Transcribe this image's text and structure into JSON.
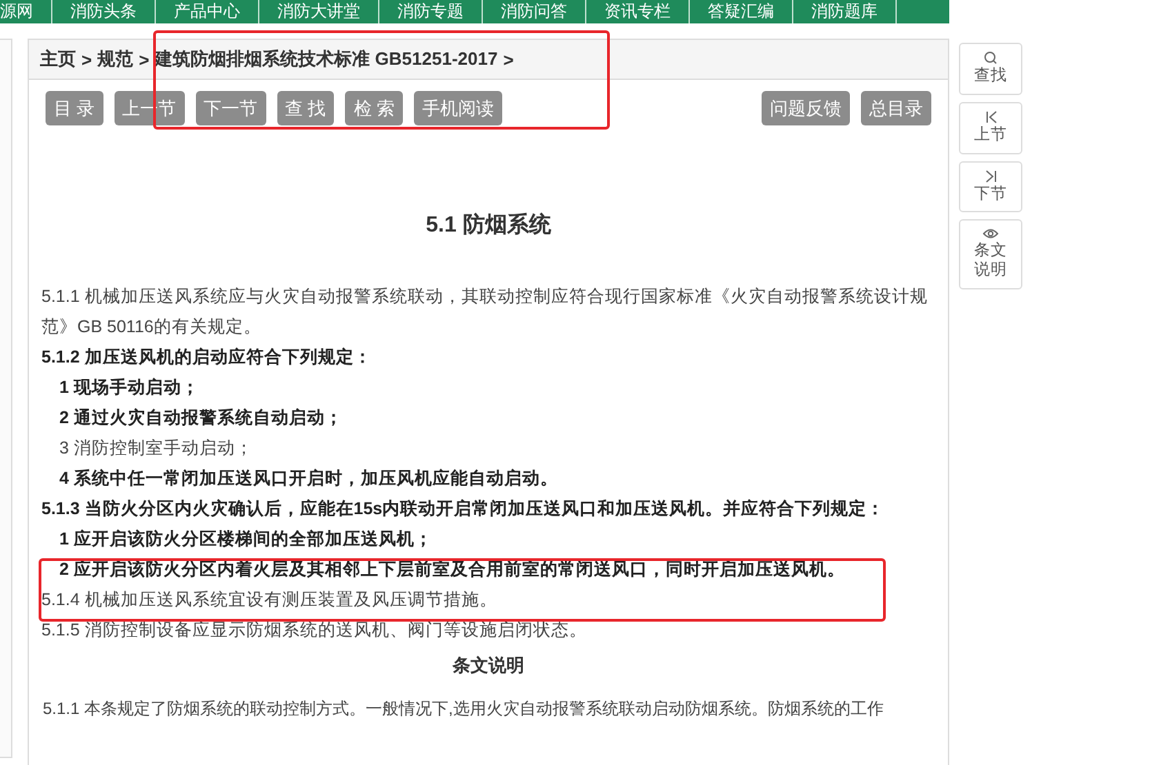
{
  "top_nav": [
    "源网",
    "消防头条",
    "产品中心",
    "消防大讲堂",
    "消防专题",
    "消防问答",
    "资讯专栏",
    "答疑汇编",
    "消防题库"
  ],
  "breadcrumb": [
    "主页",
    "规范",
    "建筑防烟排烟系统技术标准 GB51251-2017"
  ],
  "breadcrumb_separator": ">",
  "toolbar_left": [
    "目 录",
    "上一节",
    "下一节",
    "查 找",
    "检 索",
    "手机阅读"
  ],
  "toolbar_right": [
    "问题反馈",
    "总目录"
  ],
  "section_title": "5.1 防烟系统",
  "clauses": [
    {
      "kind": "clause",
      "bold": false,
      "text": "5.1.1 机械加压送风系统应与火灾自动报警系统联动，其联动控制应符合现行国家标准《火灾自动报警系统设计规范》GB 50116的有关规定。"
    },
    {
      "kind": "clause",
      "bold": true,
      "text": "5.1.2 加压送风机的启动应符合下列规定："
    },
    {
      "kind": "item",
      "bold": true,
      "text": "1 现场手动启动；"
    },
    {
      "kind": "item",
      "bold": true,
      "text": "2 通过火灾自动报警系统自动启动；"
    },
    {
      "kind": "item",
      "bold": false,
      "text": "3 消防控制室手动启动；"
    },
    {
      "kind": "item",
      "bold": true,
      "text": "4 系统中任一常闭加压送风口开启时，加压风机应能自动启动。"
    },
    {
      "kind": "clause",
      "bold": true,
      "text": "5.1.3 当防火分区内火灾确认后，应能在15s内联动开启常闭加压送风口和加压送风机。并应符合下列规定："
    },
    {
      "kind": "item",
      "bold": true,
      "text": "1 应开启该防火分区楼梯间的全部加压送风机；"
    },
    {
      "kind": "item",
      "bold": true,
      "text": "2 应开启该防火分区内着火层及其相邻上下层前室及合用前室的常闭送风口，同时开启加压送风机。"
    },
    {
      "kind": "clause",
      "bold": false,
      "text": "5.1.4 机械加压送风系统宜设有测压装置及风压调节措施。"
    },
    {
      "kind": "clause",
      "bold": false,
      "text": "5.1.5 消防控制设备应显示防烟系统的送风机、阀门等设施启闭状态。"
    }
  ],
  "explanation_title": "条文说明",
  "explanation_text": "5.1.1 本条规定了防烟系统的联动控制方式。一般情况下,选用火灾自动报警系统联动启动防烟系统。防烟系统的工作",
  "side_tools": [
    {
      "kind": "search",
      "label": "查找"
    },
    {
      "kind": "prev",
      "label": "上节"
    },
    {
      "kind": "next",
      "label": "下节"
    },
    {
      "kind": "eye",
      "label": "条文说明"
    }
  ]
}
